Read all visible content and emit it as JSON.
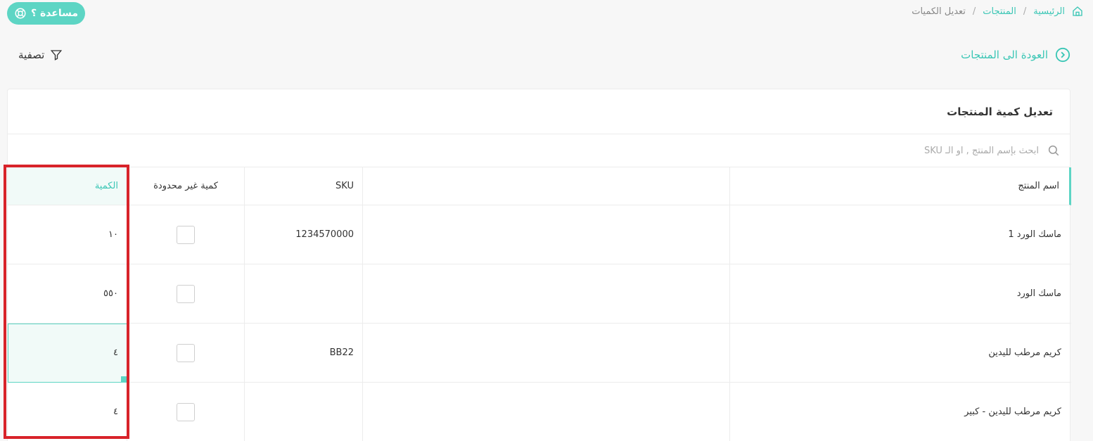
{
  "help": {
    "label": "مساعدة ؟"
  },
  "breadcrumb": [
    {
      "label": "الرئيسية"
    },
    {
      "label": "المنتجات"
    },
    {
      "label": "تعديل الكميات"
    }
  ],
  "breadcrumb_sep": "/",
  "back_link": {
    "label": "العودة الى المنتجات"
  },
  "filter": {
    "label": "تصفية"
  },
  "card": {
    "title": "تعديل كمية المنتجات"
  },
  "search": {
    "placeholder": "ابحث بإسم المنتج , او الـ SKU"
  },
  "table": {
    "headers": {
      "quantity": "الكمية",
      "unlimited": "كمية غير محدودة",
      "sku": "SKU",
      "blank": "",
      "name": "اسم المنتج"
    },
    "rows": [
      {
        "quantity": "١٠",
        "sku": "1234570000",
        "name": "ماسك الورد 1"
      },
      {
        "quantity": "٥٥٠",
        "sku": "",
        "name": "ماسك الورد"
      },
      {
        "quantity": "٤",
        "sku": "BB22",
        "name": "كريم مرطب لليدين"
      },
      {
        "quantity": "٤",
        "sku": "",
        "name": "كريم مرطب لليدين - كبير"
      }
    ]
  },
  "colors": {
    "accent": "#5dd5c4",
    "accent_text": "#3ac6b5",
    "highlight": "#d8232a"
  }
}
